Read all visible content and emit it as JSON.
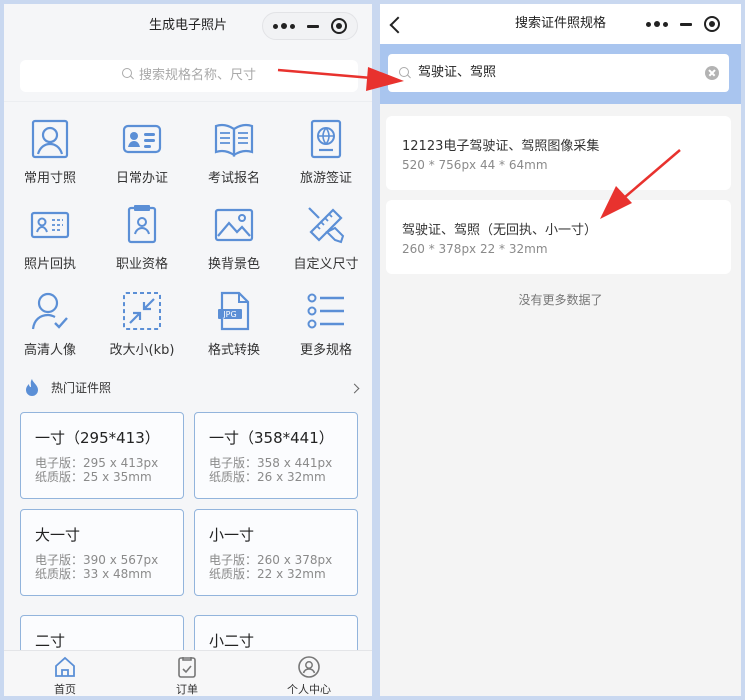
{
  "left": {
    "title": "生成电子照片",
    "search_placeholder": "搜索规格名称、尺寸",
    "grid": [
      {
        "label": "常用寸照",
        "icon": "portrait-photo-icon"
      },
      {
        "label": "日常办证",
        "icon": "id-card-icon"
      },
      {
        "label": "考试报名",
        "icon": "open-book-icon"
      },
      {
        "label": "旅游签证",
        "icon": "passport-icon"
      },
      {
        "label": "照片回执",
        "icon": "receipt-card-icon"
      },
      {
        "label": "职业资格",
        "icon": "certificate-icon"
      },
      {
        "label": "换背景色",
        "icon": "image-icon"
      },
      {
        "label": "自定义尺寸",
        "icon": "ruler-pencil-icon"
      },
      {
        "label": "高清人像",
        "icon": "person-check-icon"
      },
      {
        "label": "改大小(kb)",
        "icon": "resize-icon"
      },
      {
        "label": "格式转换",
        "icon": "jpg-file-icon"
      },
      {
        "label": "更多规格",
        "icon": "list-icon"
      }
    ],
    "hot_title": "热门证件照",
    "jpg_badge": "JPG",
    "cards": [
      {
        "name": "一寸（295*413）",
        "digital": "电子版：295 x 413px",
        "paper": "纸质版：25 x 35mm"
      },
      {
        "name": "一寸（358*441）",
        "digital": "电子版：358 x 441px",
        "paper": "纸质版：26 x 32mm"
      },
      {
        "name": "大一寸",
        "digital": "电子版：390 x 567px",
        "paper": "纸质版：33 x 48mm"
      },
      {
        "name": "小一寸",
        "digital": "电子版：260 x 378px",
        "paper": "纸质版：22 x 32mm"
      },
      {
        "name": "二寸"
      },
      {
        "name": "小二寸"
      }
    ],
    "tabs": [
      {
        "label": "首页",
        "icon": "home-icon"
      },
      {
        "label": "订单",
        "icon": "order-icon"
      },
      {
        "label": "个人中心",
        "icon": "user-center-icon"
      }
    ]
  },
  "right": {
    "title": "搜索证件照规格",
    "search_value": "驾驶证、驾照",
    "results": [
      {
        "name": "12123电子驾驶证、驾照图像采集",
        "size": "520 * 756px   44 * 64mm"
      },
      {
        "name": "驾驶证、驾照（无回执、小一寸）",
        "size": "260 * 378px   22 * 32mm"
      }
    ],
    "no_more": "没有更多数据了"
  },
  "colors": {
    "accent_blue": "#5b8fd6",
    "card_border": "#92b4dc",
    "search_band": "#a9c5ef",
    "arrow_red": "#e8322e"
  }
}
